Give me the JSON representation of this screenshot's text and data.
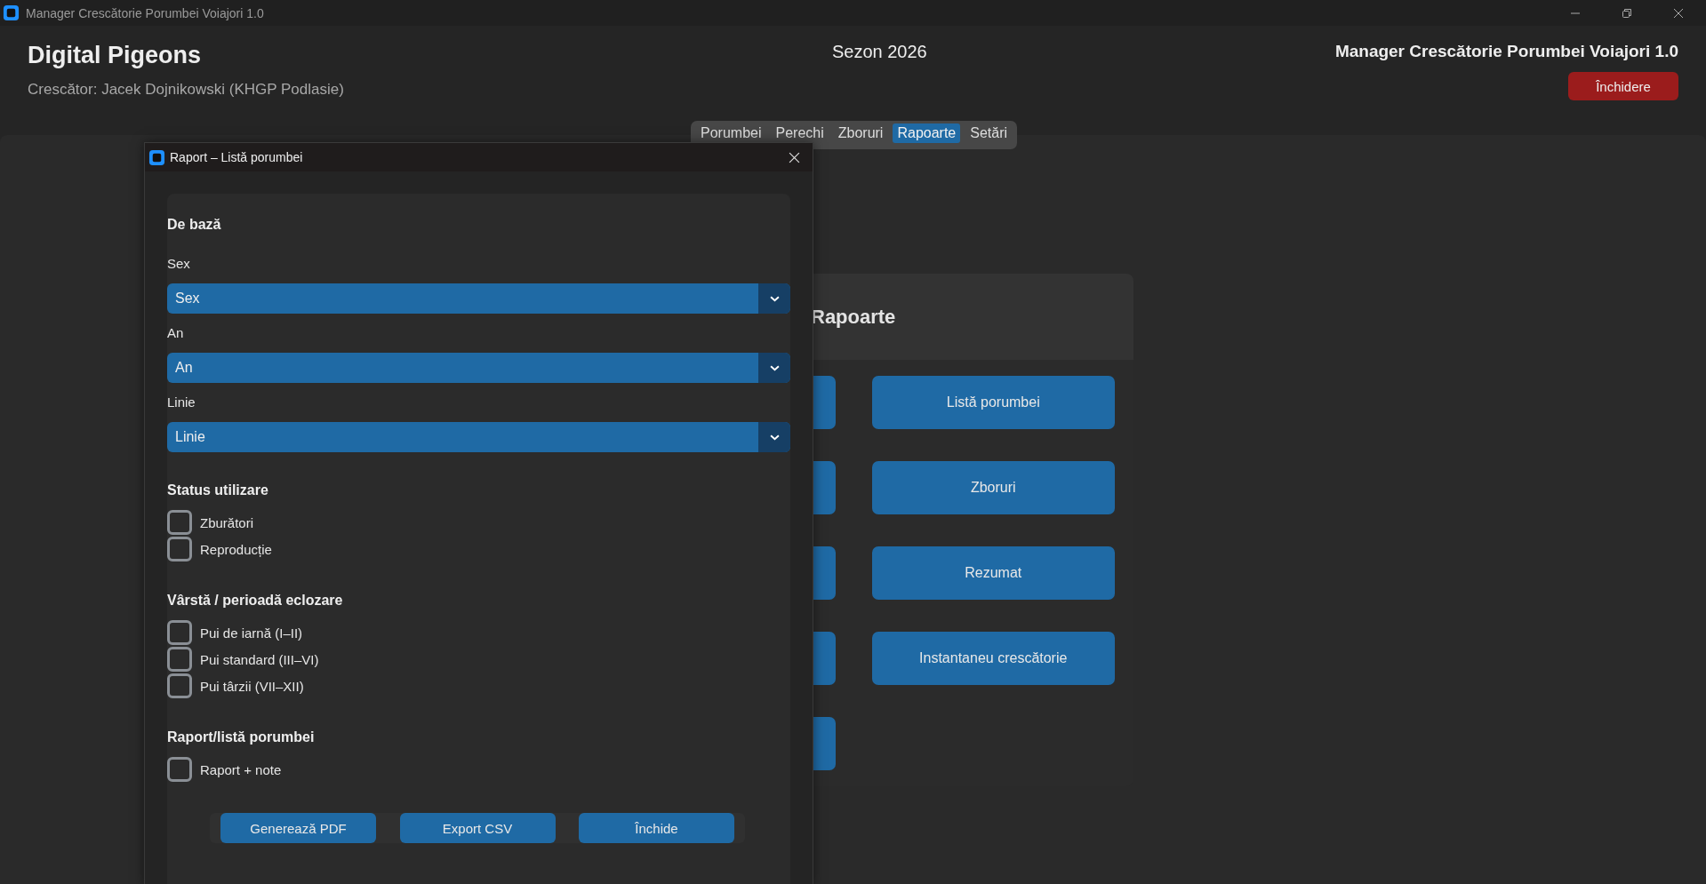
{
  "window": {
    "title": "Manager Crescătorie Porumbei Voiajori 1.0"
  },
  "header": {
    "app_name": "Digital Pigeons",
    "breeder": "Crescător: Jacek Dojnikowski (KHGP Podlasie)",
    "season": "Sezon 2026",
    "app_title": "Manager Crescătorie Porumbei Voiajori 1.0",
    "close_button": "Închidere"
  },
  "tabs": [
    {
      "label": "Porumbei",
      "selected": false
    },
    {
      "label": "Perechi",
      "selected": false
    },
    {
      "label": "Zboruri",
      "selected": false
    },
    {
      "label": "Rapoarte",
      "selected": true
    },
    {
      "label": "Setări",
      "selected": false
    }
  ],
  "reports_panel": {
    "title": "Rapoarte",
    "buttons": [
      "Listă porumbei",
      "Zboruri",
      "Rezumat",
      "Instantaneu crescătorie"
    ]
  },
  "dialog": {
    "title": "Raport – Listă porumbei",
    "sections": [
      {
        "title": "De bază",
        "items": [
          {
            "kind": "select",
            "label": "Sex",
            "value": "Sex"
          },
          {
            "kind": "select",
            "label": "An",
            "value": "An"
          },
          {
            "kind": "select",
            "label": "Linie",
            "value": "Linie"
          }
        ]
      },
      {
        "title": "Status utilizare",
        "items": [
          {
            "kind": "checkbox",
            "label": "Zburători",
            "checked": false
          },
          {
            "kind": "checkbox",
            "label": "Reproducție",
            "checked": false
          }
        ]
      },
      {
        "title": "Vârstă / perioadă eclozare",
        "items": [
          {
            "kind": "checkbox",
            "label": "Pui de iarnă (I–II)",
            "checked": false
          },
          {
            "kind": "checkbox",
            "label": "Pui standard (III–VI)",
            "checked": false
          },
          {
            "kind": "checkbox",
            "label": "Pui târzii (VII–XII)",
            "checked": false
          }
        ]
      },
      {
        "title": "Raport/listă porumbei",
        "items": [
          {
            "kind": "checkbox",
            "label": "Raport + note",
            "checked": false
          }
        ]
      }
    ],
    "buttons": [
      "Generează PDF",
      "Export CSV",
      "Închide"
    ]
  }
}
